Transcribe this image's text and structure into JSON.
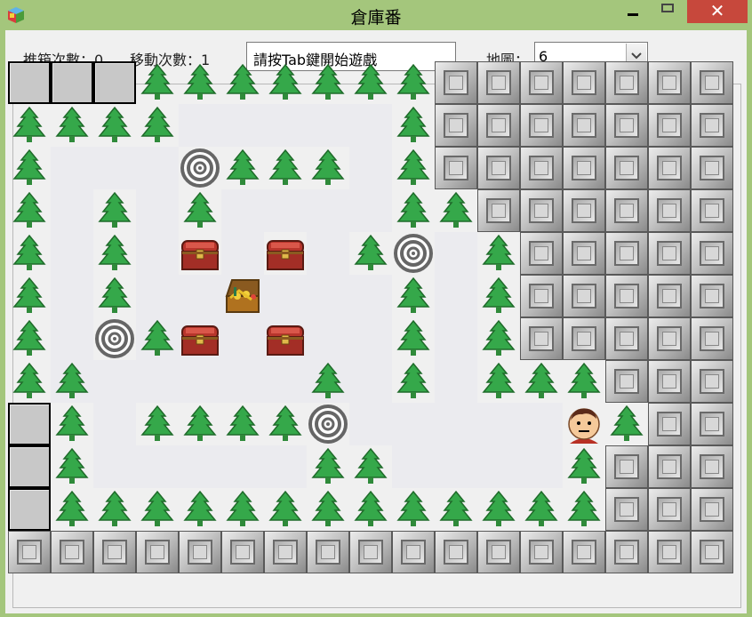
{
  "window": {
    "title": "倉庫番",
    "icon": "cube-app-icon",
    "controls": {
      "minimize": "minimize-icon",
      "maximize": "maximize-icon",
      "close": "✕"
    }
  },
  "toolbar": {
    "push_label": "推箱次數：0",
    "move_label": "移動次數：1",
    "status_message": "請按Tab鍵開始遊戲",
    "map_label": "地圖：",
    "map_value": "6",
    "map_dropdown_icon": "chevron-down-icon"
  },
  "board": {
    "columns": 17,
    "rows": 12,
    "legend": {
      "W": "wall-block",
      "B": "brick-block",
      "T": "tree-icon",
      "G": "goal-target-icon",
      "C": "treasure-chest-icon",
      "O": "open-chest-icon",
      "P": "player-face-icon",
      ".": "floor",
      "_": "empty"
    },
    "grid": [
      "WWWTTTTTTTBBBBBBB",
      "TTTT_____TBBBBBBB",
      "T___GTTT_TBBBBBBB",
      "T_T_T____TTBBBBBB",
      "T_T_C_C_TG_TBBBBBB",
      "T_T__O___T_TBBBBBB",
      "T_GTC_C__T_TBBBBBB",
      "TT_____T_T_TTTBBBB",
      "WT_TTTTG_____PTBBBB",
      "WT_____TT____TBBBB",
      "WTTTTTTTTTTTTTBBBB",
      "BBBBBBBBBBBBBBBBB"
    ]
  },
  "colors": {
    "titlebar": "#a4c67c",
    "close_button": "#c7483c",
    "tree": "#35a84a",
    "chest": "#b8352c",
    "floor": "#ebebef"
  }
}
